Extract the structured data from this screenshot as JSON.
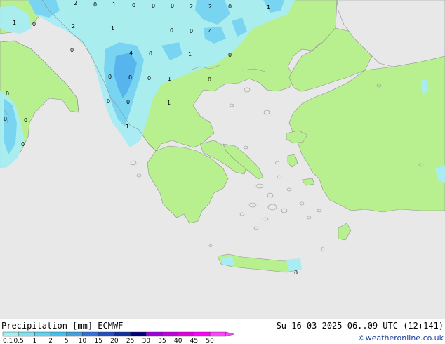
{
  "footer": {
    "title_left": "Precipitation [mm] ECMWF",
    "title_right": "Su 16-03-2025 06..09 UTC (12+141)",
    "credit": "©weatheronline.co.uk"
  },
  "legend": {
    "labels": [
      "0.1",
      "0.5",
      "1",
      "2",
      "5",
      "10",
      "15",
      "20",
      "25",
      "30",
      "35",
      "40",
      "45",
      "50"
    ],
    "colors": [
      "#a0f0f0",
      "#80e0f0",
      "#60d0f0",
      "#40c0f0",
      "#40a0e0",
      "#3070e0",
      "#2050c0",
      "#1030a0",
      "#000080",
      "#a000e0",
      "#c000e0",
      "#e000e0",
      "#ff00ff",
      "#ff40ff"
    ]
  },
  "colors": {
    "sea": "#e8e8e8",
    "land": "#b8f090",
    "precip_light": "#a8ecf4",
    "precip_mid": "#78d4f0",
    "precip_heavy": "#58b4ec",
    "coast": "#909090"
  },
  "map_labels": [
    {
      "text": "2"
    },
    {
      "text": "0"
    },
    {
      "text": "1"
    },
    {
      "text": "0"
    },
    {
      "text": "0"
    },
    {
      "text": "0"
    },
    {
      "text": "2"
    },
    {
      "text": "2"
    },
    {
      "text": "0"
    },
    {
      "text": "1"
    },
    {
      "text": "1"
    },
    {
      "text": "0"
    },
    {
      "text": "2"
    },
    {
      "text": "1"
    },
    {
      "text": "0"
    },
    {
      "text": "0"
    },
    {
      "text": "4"
    },
    {
      "text": "0"
    },
    {
      "text": "4"
    },
    {
      "text": "0"
    },
    {
      "text": "1"
    },
    {
      "text": "0"
    },
    {
      "text": "0"
    },
    {
      "text": "0"
    },
    {
      "text": "0"
    },
    {
      "text": "1"
    },
    {
      "text": "0"
    },
    {
      "text": "0"
    },
    {
      "text": "0"
    },
    {
      "text": "0"
    },
    {
      "text": "1"
    },
    {
      "text": "0"
    },
    {
      "text": "0"
    },
    {
      "text": "1"
    },
    {
      "text": "0"
    },
    {
      "text": "0"
    }
  ]
}
